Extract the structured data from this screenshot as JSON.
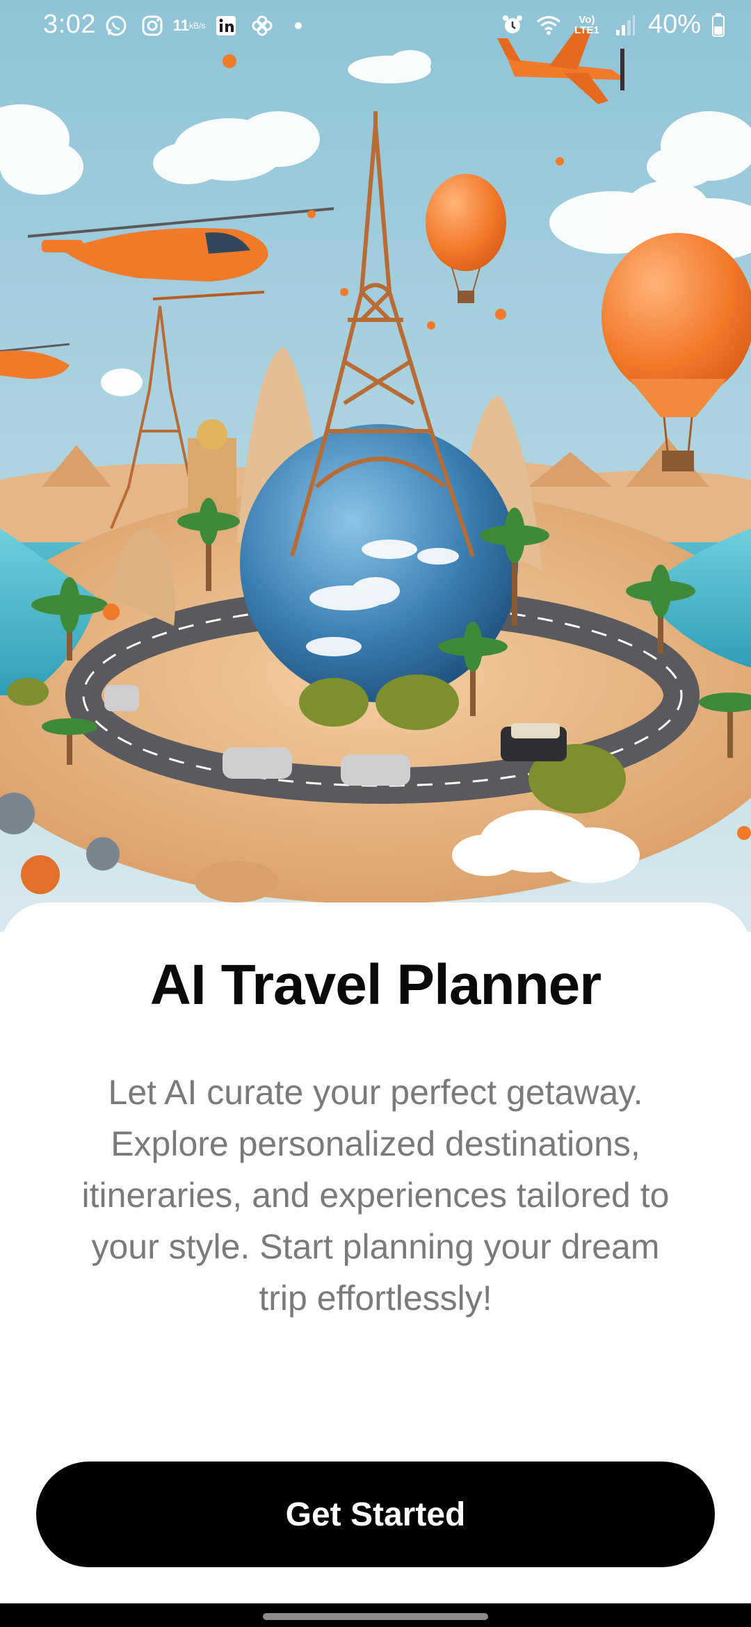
{
  "status_bar": {
    "time": "3:02",
    "net_speed_value": "11",
    "net_speed_unit": "kB/s",
    "network_label_top": "Vo)",
    "network_label_bottom": "LTE1",
    "battery": "40%",
    "icons": [
      "whatsapp-icon",
      "instagram-icon",
      "linkedin-icon",
      "pinwheel-icon",
      "dot-icon",
      "alarm-icon",
      "wifi-icon",
      "signal-icon",
      "battery-icon"
    ]
  },
  "hero": {
    "description": "travel-illustration",
    "colors": {
      "sky": "#a9cfdc",
      "sand": "#e8b98a",
      "water": "#4ab7c9",
      "accent": "#f27a2a",
      "globe": "#3a7fb3"
    }
  },
  "onboarding": {
    "title": "AI Travel Planner",
    "description": "Let AI curate your perfect getaway. Explore personalized destinations, itineraries, and experiences tailored to your style. Start planning your dream trip effortlessly!",
    "cta_label": "Get Started"
  }
}
